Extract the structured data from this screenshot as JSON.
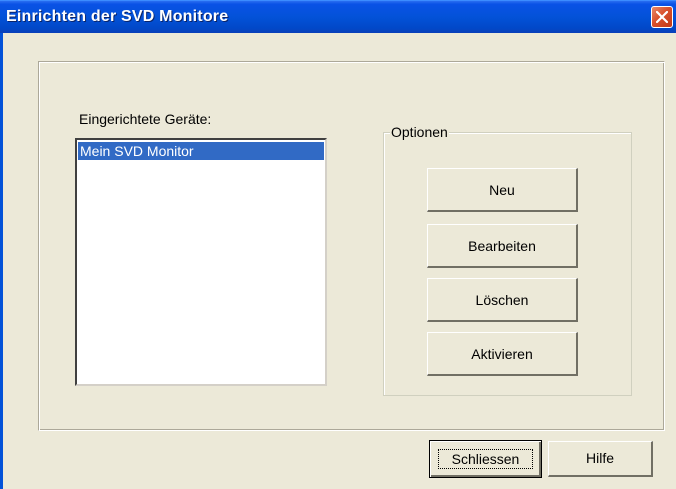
{
  "window": {
    "title": "Einrichten der SVD Monitore",
    "title_bar_color": "#0352d8",
    "close_icon": "close-icon"
  },
  "devices": {
    "label": "Eingerichtete Geräte:",
    "items": [
      {
        "label": "Mein SVD Monitor",
        "selected": true
      }
    ],
    "selection_color": "#316ac5"
  },
  "options": {
    "group_label": "Optionen",
    "buttons": {
      "new": "Neu",
      "edit": "Bearbeiten",
      "delete": "Löschen",
      "activate": "Aktivieren"
    }
  },
  "footer": {
    "close_label": "Schliessen",
    "help_label": "Hilfe"
  }
}
